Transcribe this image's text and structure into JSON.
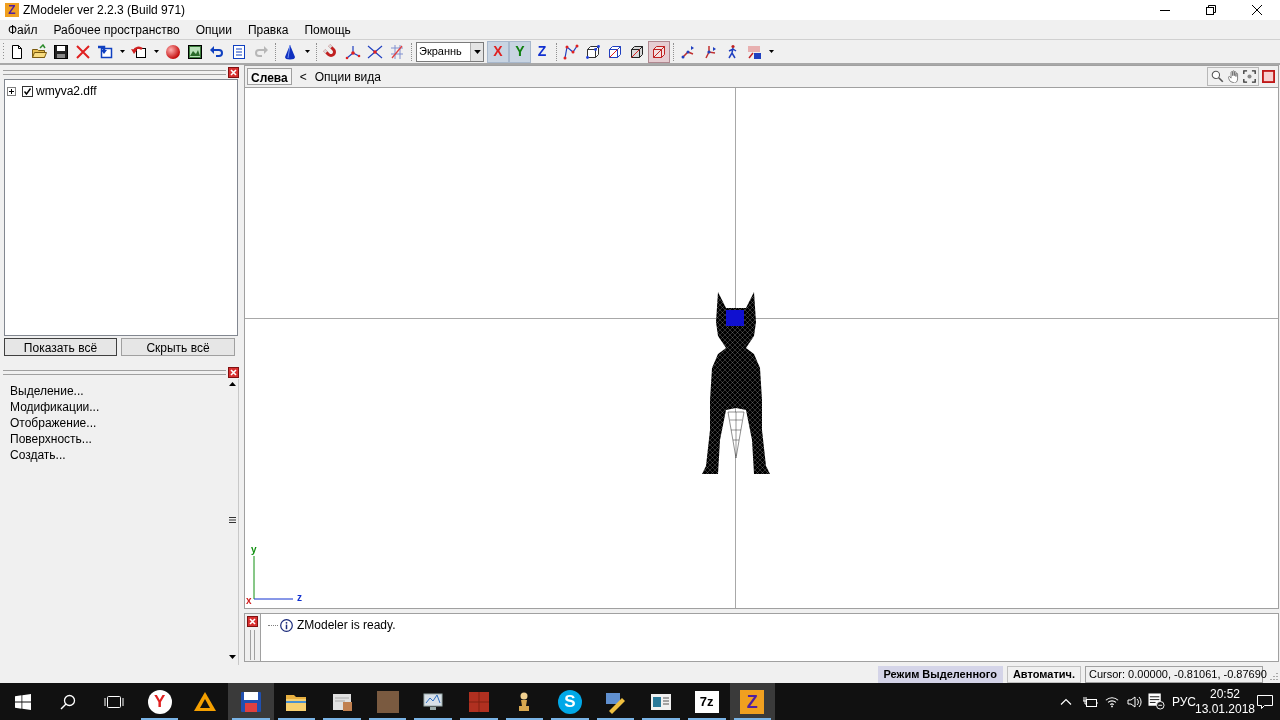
{
  "window": {
    "logo": "Z",
    "title": "ZModeler ver 2.2.3 (Build 971)"
  },
  "menu": [
    {
      "label": "Файл"
    },
    {
      "label": "Рабочее пространство"
    },
    {
      "label": "Опции"
    },
    {
      "label": "Правка"
    },
    {
      "label": "Помощь"
    }
  ],
  "toolbar": [
    {
      "kind": "button",
      "disabled": false
    },
    {
      "kind": "button",
      "disabled": false
    },
    {
      "kind": "button",
      "disabled": false
    },
    {
      "kind": "button",
      "disabled": false
    },
    {
      "kind": "split",
      "disabled": false
    },
    {
      "kind": "split",
      "disabled": false
    },
    {
      "kind": "button",
      "disabled": false
    },
    {
      "kind": "button",
      "disabled": false
    },
    {
      "kind": "button",
      "disabled": false
    },
    {
      "kind": "button",
      "disabled": false
    },
    {
      "kind": "button",
      "disabled": true
    },
    {
      "kind": "separator"
    },
    {
      "kind": "split",
      "disabled": false
    },
    {
      "kind": "separator"
    },
    {
      "kind": "button",
      "disabled": false
    },
    {
      "kind": "button",
      "disabled": false
    },
    {
      "kind": "button",
      "disabled": false
    },
    {
      "kind": "button",
      "disabled": false
    },
    {
      "kind": "separator"
    },
    {
      "kind": "select",
      "value": "Экраннь"
    },
    {
      "kind": "toggle",
      "label": "X",
      "color": "#e02020",
      "selected": true
    },
    {
      "kind": "toggle",
      "label": "Y",
      "color": "#108010",
      "selected": true
    },
    {
      "kind": "toggle",
      "label": "Z",
      "color": "#1030d0",
      "selected": false
    },
    {
      "kind": "separator"
    },
    {
      "kind": "mode",
      "selected": false
    },
    {
      "kind": "mode",
      "selected": false
    },
    {
      "kind": "mode",
      "selected": false
    },
    {
      "kind": "mode",
      "selected": false
    },
    {
      "kind": "mode",
      "selected": true
    },
    {
      "kind": "separator"
    },
    {
      "kind": "button",
      "disabled": false
    },
    {
      "kind": "button",
      "disabled": false
    },
    {
      "kind": "button",
      "disabled": false
    },
    {
      "kind": "split",
      "disabled": false
    }
  ],
  "scene_tree": {
    "items": [
      {
        "label": "wmyva2.dff",
        "checked": true,
        "expanded": false
      }
    ],
    "buttons": [
      {
        "label": "Показать всё"
      },
      {
        "label": "Скрыть всё"
      }
    ]
  },
  "tool_panel": {
    "items": [
      {
        "label": "Выделение..."
      },
      {
        "label": "Модификации..."
      },
      {
        "label": "Отображение..."
      },
      {
        "label": "Поверхность..."
      },
      {
        "label": "Создать..."
      }
    ]
  },
  "viewport": {
    "tab": "Слева",
    "options": {
      "arrow": "<",
      "label": "Опции вида"
    },
    "gizmo_labels": [
      {
        "text": "y",
        "color": "#109010"
      },
      {
        "text": "z",
        "color": "#1030d0"
      },
      {
        "text": "x",
        "color": "#d02020"
      }
    ]
  },
  "log": {
    "entries": [
      {
        "kind": "info",
        "text": "ZModeler is ready."
      }
    ]
  },
  "status_bar": [
    {
      "kind": "mode",
      "text": "Режим Выделенного",
      "on": true
    },
    {
      "kind": "mode",
      "text": "Автоматич.",
      "on": false
    },
    {
      "kind": "readout",
      "text": "Cursor: 0.00000, -0.81061, -0.87690"
    }
  ],
  "taskbar": {
    "apps": [
      {
        "glyph": "Y",
        "running": true,
        "selected": false
      },
      {
        "running": false,
        "selected": false
      },
      {
        "running": true,
        "selected": true
      },
      {
        "running": true,
        "selected": false
      },
      {
        "running": true,
        "selected": false
      },
      {
        "running": true,
        "selected": false
      },
      {
        "running": true,
        "selected": false
      },
      {
        "running": true,
        "selected": false
      },
      {
        "running": true,
        "selected": false
      },
      {
        "glyph": "S",
        "running": true,
        "selected": false
      },
      {
        "running": true,
        "selected": false
      },
      {
        "running": true,
        "selected": false
      },
      {
        "glyph": "7z",
        "running": true,
        "selected": false
      },
      {
        "glyph": "Z",
        "running": true,
        "selected": true
      }
    ],
    "tray": {
      "language": "РУС",
      "time": "20:52",
      "date": "13.01.2018"
    }
  }
}
